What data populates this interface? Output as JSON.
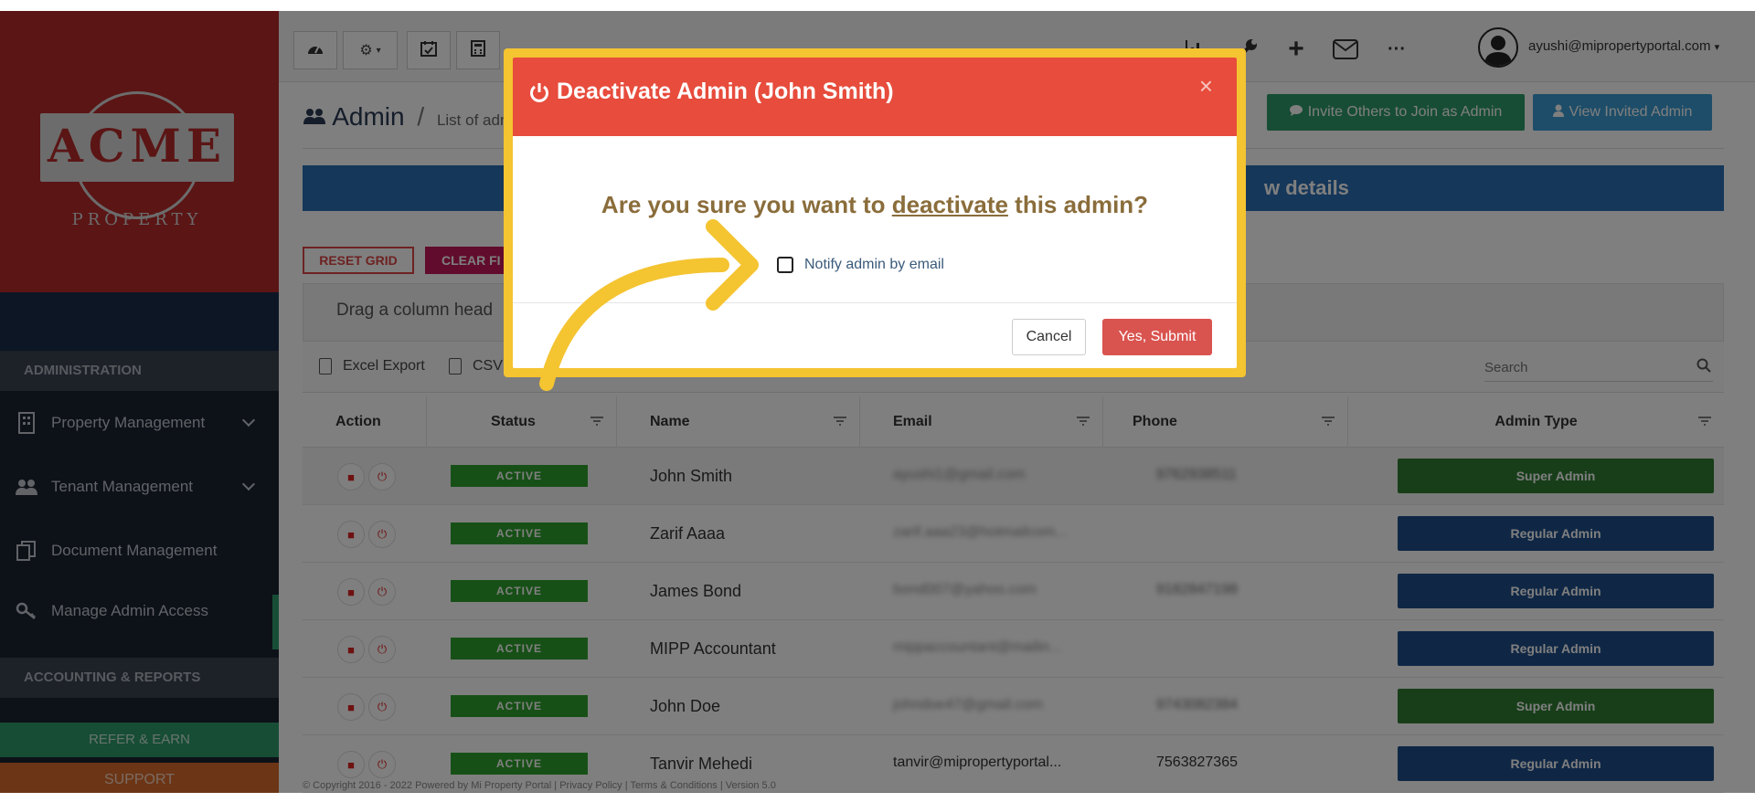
{
  "brand": {
    "logo_text": "ACME",
    "logo_sub": "PROPERTY",
    "colors": {
      "sidebar": "#1a2230",
      "logo_bg": "#b72a2a",
      "accent_green": "#2f9a6a",
      "highlight": "#f4c431",
      "danger": "#e74c3c"
    }
  },
  "sidebar": {
    "sections": [
      {
        "header": "ADMINISTRATION"
      },
      {
        "header": "ACCOUNTING & REPORTS"
      }
    ],
    "items": [
      {
        "label": "Property Management",
        "icon": "building-icon",
        "has_chevron": true
      },
      {
        "label": "Tenant Management",
        "icon": "users-icon",
        "has_chevron": true
      },
      {
        "label": "Document Management",
        "icon": "documents-icon",
        "has_chevron": false
      },
      {
        "label": "Manage Admin Access",
        "icon": "key-icon",
        "has_chevron": false,
        "active": true
      }
    ],
    "refer_label": "REFER & EARN",
    "support_label": "SUPPORT"
  },
  "topbar": {
    "icons": [
      "dashboard-icon",
      "gear-icon",
      "calendar-check-icon",
      "calculator-icon",
      "chart-icon",
      "wrench-icon",
      "plus-icon",
      "mail-icon",
      "more-icon"
    ],
    "user_email": "ayushi@mipropertyportal.com"
  },
  "page": {
    "title": "Admin",
    "separator": "/",
    "subtitle": "List of adm",
    "invite_label": "Invite Others to Join as Admin",
    "view_invited_label": "View Invited Admin",
    "banner_text": "w details",
    "reset_label": "RESET GRID",
    "clear_label": "CLEAR FI",
    "group_hint": "Drag a column head",
    "excel_label": "Excel Export",
    "csv_label": "CSV",
    "search_placeholder": "Search"
  },
  "grid": {
    "columns": [
      "Action",
      "Status",
      "Name",
      "Email",
      "Phone",
      "Admin Type"
    ],
    "rows": [
      {
        "status": "ACTIVE",
        "name": "John Smith",
        "email": "ayushi1@gmail.com",
        "phone": "9762938511",
        "type": "Super Admin",
        "type_color": "#2e7d32"
      },
      {
        "status": "ACTIVE",
        "name": "Zarif Aaaa",
        "email": "zarif.aaa23@hotmailcom...",
        "phone": "",
        "type": "Regular Admin",
        "type_color": "#1f4e8a"
      },
      {
        "status": "ACTIVE",
        "name": "James Bond",
        "email": "bond007@yahoo.com",
        "phone": "9182847198",
        "type": "Regular Admin",
        "type_color": "#1f4e8a"
      },
      {
        "status": "ACTIVE",
        "name": "MIPP Accountant",
        "email": "mippaccountant@mailin...",
        "phone": "",
        "type": "Regular Admin",
        "type_color": "#1f4e8a"
      },
      {
        "status": "ACTIVE",
        "name": "John Doe",
        "email": "johndoe47@gmail.com",
        "phone": "9743082384",
        "type": "Super Admin",
        "type_color": "#2e7d32"
      },
      {
        "status": "ACTIVE",
        "name": "Tanvir Mehedi",
        "email": "tanvir@mipropertyportal...",
        "phone": "7563827365",
        "type": "Regular Admin",
        "type_color": "#1f4e8a"
      }
    ]
  },
  "footer": {
    "text": "© Copyright 2016 - 2022 Powered by Mi Property Portal | Privacy Policy | Terms & Conditions | Version 5.0"
  },
  "modal": {
    "title": "Deactivate Admin (John Smith)",
    "close_glyph": "×",
    "question_before": "Are you sure you want to ",
    "question_keyword": "deactivate",
    "question_after": " this admin?",
    "notify_label": "Notify admin by email",
    "notify_checked": false,
    "cancel_label": "Cancel",
    "submit_label": "Yes, Submit"
  }
}
